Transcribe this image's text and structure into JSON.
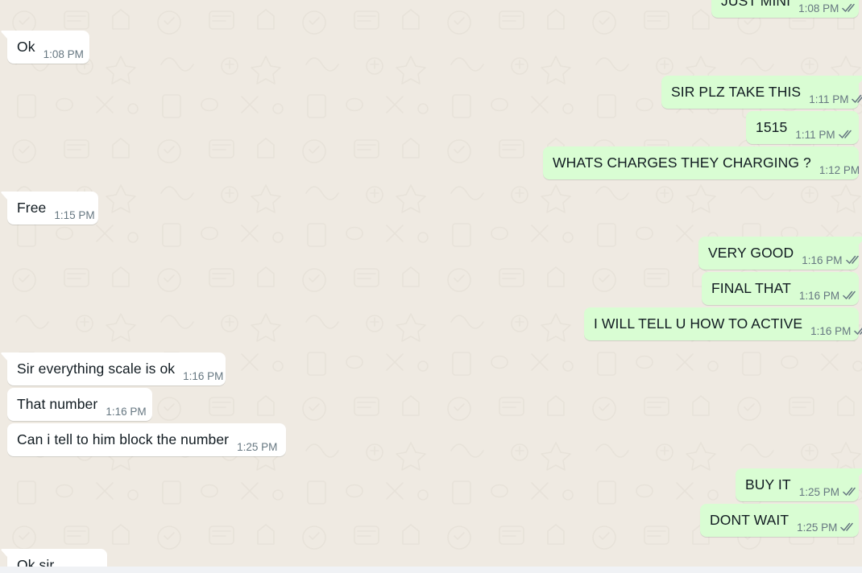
{
  "chat": {
    "messages": [
      {
        "dir": "out",
        "text": "JUST MINI",
        "time": "1:08 PM"
      },
      {
        "dir": "in",
        "text": "Ok",
        "time": "1:08 PM"
      },
      {
        "dir": "out",
        "text": "SIR PLZ TAKE THIS",
        "time": "1:11 PM"
      },
      {
        "dir": "out",
        "text": "1515",
        "time": "1:11 PM"
      },
      {
        "dir": "out",
        "text": "WHATS CHARGES THEY CHARGING ?",
        "time": "1:12 PM"
      },
      {
        "dir": "in",
        "text": "Free",
        "time": "1:15 PM"
      },
      {
        "dir": "out",
        "text": "VERY GOOD",
        "time": "1:16 PM"
      },
      {
        "dir": "out",
        "text": "FINAL THAT",
        "time": "1:16 PM"
      },
      {
        "dir": "out",
        "text": "I WILL TELL U HOW TO ACTIVE",
        "time": "1:16 PM"
      },
      {
        "dir": "in",
        "text": "Sir everything scale is ok",
        "time": "1:16 PM"
      },
      {
        "dir": "in",
        "text": "That number",
        "time": "1:16 PM"
      },
      {
        "dir": "in",
        "text": "Can i tell to him block the number",
        "time": "1:25 PM"
      },
      {
        "dir": "out",
        "text": "BUY IT",
        "time": "1:25 PM"
      },
      {
        "dir": "out",
        "text": "DONT WAIT",
        "time": "1:25 PM"
      },
      {
        "dir": "in",
        "text": "Ok sir",
        "time": ""
      }
    ]
  },
  "icons": {
    "read_receipt": "double-check-icon"
  },
  "colors": {
    "background": "#efeae2",
    "incoming_bubble": "#ffffff",
    "outgoing_bubble": "#d9fdd3",
    "timestamp": "#667781",
    "read_tick": "#667781"
  }
}
